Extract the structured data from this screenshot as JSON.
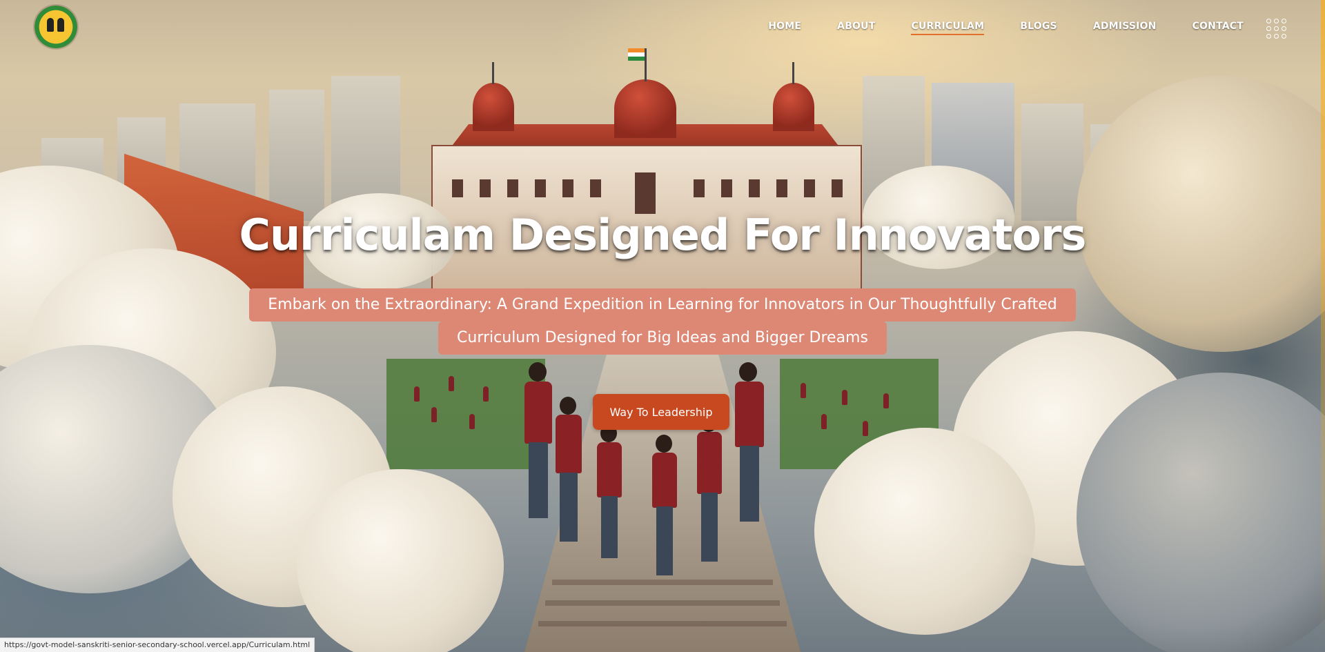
{
  "nav": {
    "logo_alt": "school-logo",
    "items": [
      {
        "label": "HOME",
        "active": false
      },
      {
        "label": "ABOUT",
        "active": false
      },
      {
        "label": "CURRICULAM",
        "active": true
      },
      {
        "label": "BLOGS",
        "active": false
      },
      {
        "label": "ADMISSION",
        "active": false
      },
      {
        "label": "CONTACT",
        "active": false
      }
    ],
    "menu_icon": "grid-menu-icon"
  },
  "hero": {
    "title": "Curriculam Designed For Innovators",
    "subtitle_line1": "Embark on the Extraordinary: A Grand Expedition in Learning for Innovators in Our Thoughtfully Crafted",
    "subtitle_line2": "Curriculum Designed for Big Ideas and Bigger Dreams",
    "cta_label": "Way To Leadership"
  },
  "status_bar": {
    "url": "https://govt-model-sanskriti-senior-secondary-school.vercel.app/Curriculam.html"
  },
  "colors": {
    "accent": "#e2702c",
    "cta": "#c84820",
    "subtitle_bg": "#dd8775"
  }
}
